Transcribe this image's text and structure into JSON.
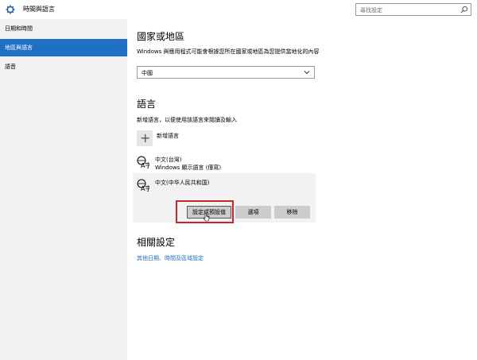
{
  "app": {
    "title": "時間與語言"
  },
  "search": {
    "placeholder": "尋找設定"
  },
  "sidebar": {
    "items": [
      {
        "label": "日期和時間"
      },
      {
        "label": "地區與語言"
      },
      {
        "label": "語音"
      }
    ]
  },
  "region": {
    "heading": "國家或地區",
    "description": "Windows 與應用程式可能會根據您所在國家或地區為您提供當地化的內容",
    "selected": "中國"
  },
  "language": {
    "heading": "語言",
    "description": "新增語言，以便使用該語言來閱讀及輸入",
    "add_label": "新增語言",
    "items": [
      {
        "name": "中文(台灣)",
        "sub": "Windows 顯示語言 (僅寫)"
      },
      {
        "name": "中文(中华人民共和国)"
      }
    ],
    "buttons": {
      "options": "設定成預設值",
      "settings": "選項",
      "remove": "移除"
    }
  },
  "related": {
    "heading": "相關設定",
    "link": "其他日期、時間及區域設定"
  },
  "colors": {
    "accent": "#1f6fc5",
    "highlight": "#c62828",
    "sidebar": "#f2f2f2"
  }
}
